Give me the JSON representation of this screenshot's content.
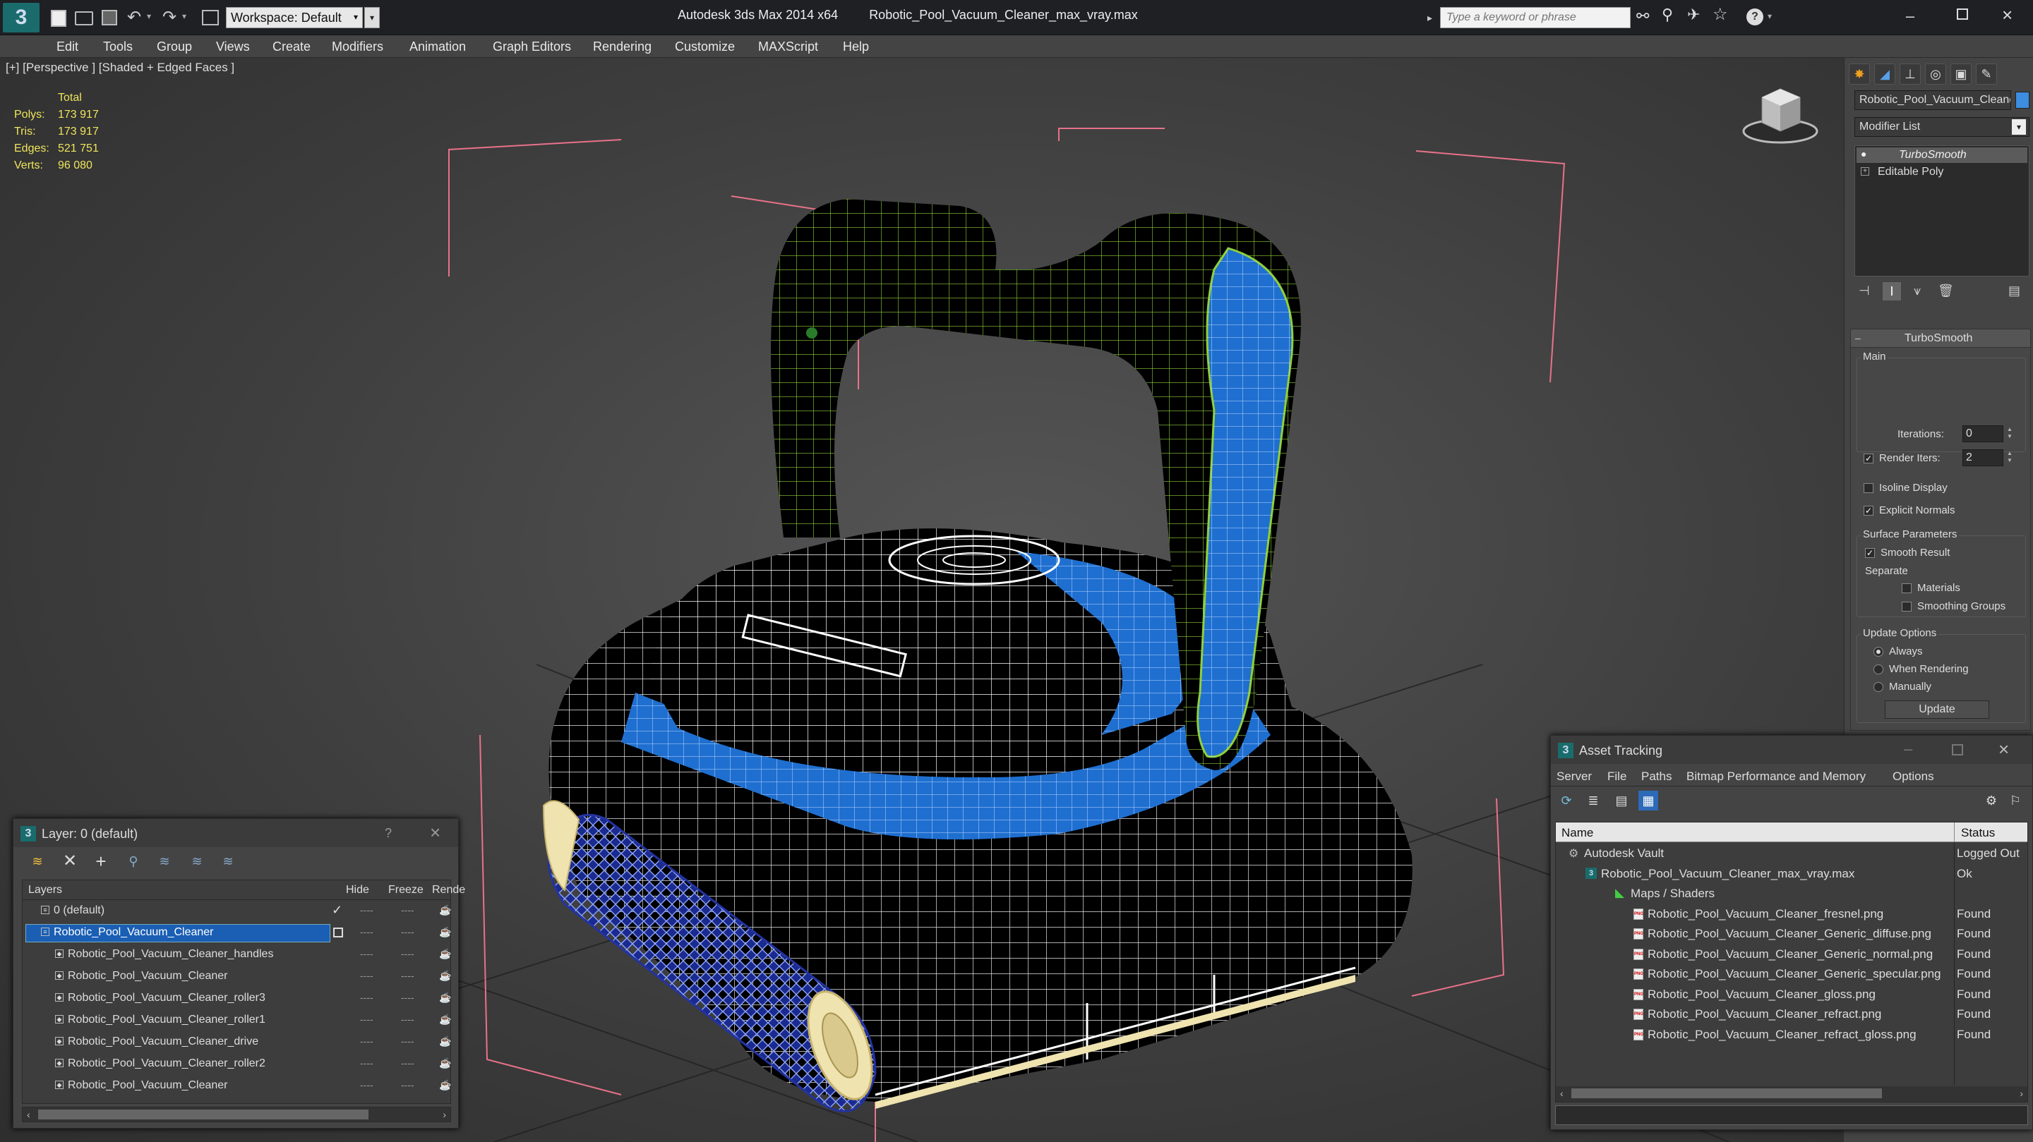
{
  "app": {
    "title": "Autodesk 3ds Max  2014 x64",
    "file": "Robotic_Pool_Vacuum_Cleaner_max_vray.max",
    "workspace": "Workspace: Default",
    "search_placeholder": "Type a keyword or phrase"
  },
  "menu": [
    "Edit",
    "Tools",
    "Group",
    "Views",
    "Create",
    "Modifiers",
    "Animation",
    "Graph Editors",
    "Rendering",
    "Customize",
    "MAXScript",
    "Help"
  ],
  "viewport": {
    "label": "[+] [Perspective ] [Shaded + Edged Faces ]",
    "stats": {
      "header": "Total",
      "rows": [
        {
          "label": "Polys:",
          "value": "173 917"
        },
        {
          "label": "Tris:",
          "value": "173 917"
        },
        {
          "label": "Edges:",
          "value": "521 751"
        },
        {
          "label": "Verts:",
          "value": "96 080"
        }
      ]
    }
  },
  "command_panel": {
    "object_name": "Robotic_Pool_Vacuum_Cleaner",
    "object_color": "#3d8de0",
    "modifier_list": "Modifier List",
    "stack": [
      {
        "name": "TurboSmooth",
        "selected": true
      },
      {
        "name": "Editable Poly",
        "selected": false
      }
    ],
    "rollout_title": "TurboSmooth",
    "main_label": "Main",
    "iterations_label": "Iterations:",
    "iterations_value": "0",
    "render_iters_label": "Render Iters:",
    "render_iters_value": "2",
    "isoline_label": "Isoline Display",
    "explicit_normals_label": "Explicit Normals",
    "surface_params_label": "Surface Parameters",
    "smooth_result_label": "Smooth Result",
    "separate_label": "Separate",
    "materials_label": "Materials",
    "smoothing_groups_label": "Smoothing Groups",
    "update_options_label": "Update Options",
    "always_label": "Always",
    "when_rendering_label": "When Rendering",
    "manually_label": "Manually",
    "update_button": "Update"
  },
  "layer_window": {
    "title": "Layer: 0 (default)",
    "help": "?",
    "columns": [
      "Layers",
      "Hide",
      "Freeze",
      "Rende"
    ],
    "rows": [
      {
        "name": "0 (default)",
        "indent": 1,
        "selected": false
      },
      {
        "name": "Robotic_Pool_Vacuum_Cleaner",
        "indent": 1,
        "selected": true
      },
      {
        "name": "Robotic_Pool_Vacuum_Cleaner_handles",
        "indent": 2,
        "selected": false
      },
      {
        "name": "Robotic_Pool_Vacuum_Cleaner",
        "indent": 2,
        "selected": false
      },
      {
        "name": "Robotic_Pool_Vacuum_Cleaner_roller3",
        "indent": 2,
        "selected": false
      },
      {
        "name": "Robotic_Pool_Vacuum_Cleaner_roller1",
        "indent": 2,
        "selected": false
      },
      {
        "name": "Robotic_Pool_Vacuum_Cleaner_drive",
        "indent": 2,
        "selected": false
      },
      {
        "name": "Robotic_Pool_Vacuum_Cleaner_roller2",
        "indent": 2,
        "selected": false
      },
      {
        "name": "Robotic_Pool_Vacuum_Cleaner",
        "indent": 2,
        "selected": false
      }
    ]
  },
  "asset_window": {
    "title": "Asset Tracking",
    "menu": [
      "Server",
      "File",
      "Paths",
      "Bitmap Performance and Memory",
      "Options"
    ],
    "columns": [
      "Name",
      "Status"
    ],
    "rows": [
      {
        "name": "Autodesk Vault",
        "status": "Logged Out",
        "level": 1,
        "kind": "vault"
      },
      {
        "name": "Robotic_Pool_Vacuum_Cleaner_max_vray.max",
        "status": "Ok",
        "level": 2,
        "kind": "max"
      },
      {
        "name": "Maps / Shaders",
        "status": "",
        "level": 3,
        "kind": "folder"
      },
      {
        "name": "Robotic_Pool_Vacuum_Cleaner_fresnel.png",
        "status": "Found",
        "level": 4,
        "kind": "png"
      },
      {
        "name": "Robotic_Pool_Vacuum_Cleaner_Generic_diffuse.png",
        "status": "Found",
        "level": 4,
        "kind": "png"
      },
      {
        "name": "Robotic_Pool_Vacuum_Cleaner_Generic_normal.png",
        "status": "Found",
        "level": 4,
        "kind": "png"
      },
      {
        "name": "Robotic_Pool_Vacuum_Cleaner_Generic_specular.png",
        "status": "Found",
        "level": 4,
        "kind": "png"
      },
      {
        "name": "Robotic_Pool_Vacuum_Cleaner_gloss.png",
        "status": "Found",
        "level": 4,
        "kind": "png"
      },
      {
        "name": "Robotic_Pool_Vacuum_Cleaner_refract.png",
        "status": "Found",
        "level": 4,
        "kind": "png"
      },
      {
        "name": "Robotic_Pool_Vacuum_Cleaner_refract_gloss.png",
        "status": "Found",
        "level": 4,
        "kind": "png"
      }
    ]
  },
  "colors": {
    "accent_blue": "#1a5fb4",
    "stat_yellow": "#f0e55c",
    "wire_green": "#9bd33a",
    "model_blue": "#1f6fd0"
  }
}
